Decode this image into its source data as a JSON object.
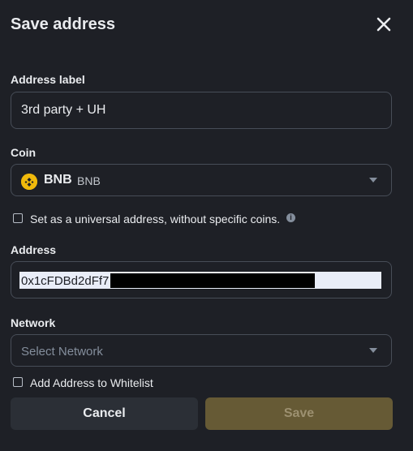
{
  "dialog": {
    "title": "Save address",
    "close_icon": "close-icon"
  },
  "address_label": {
    "label": "Address label",
    "value": "3rd party + UH"
  },
  "coin": {
    "label": "Coin",
    "symbol": "BNB",
    "name": "BNB",
    "icon": "bnb-coin-icon",
    "icon_color": "#f0b90b"
  },
  "universal": {
    "label": "Set as a universal address, without specific coins.",
    "checked": false,
    "info_icon": "info-icon"
  },
  "address": {
    "label": "Address",
    "value": "0x1cFDBd2dFf7",
    "redacted": true
  },
  "network": {
    "label": "Network",
    "placeholder": "Select Network"
  },
  "whitelist": {
    "label": "Add Address to Whitelist",
    "checked": false
  },
  "buttons": {
    "cancel": "Cancel",
    "save": "Save"
  },
  "colors": {
    "background": "#1e2026",
    "accent": "#f0b90b",
    "save_disabled": "#665a35"
  }
}
